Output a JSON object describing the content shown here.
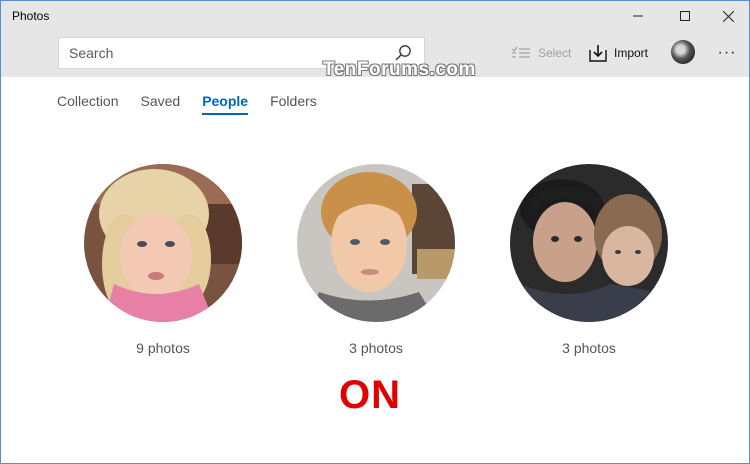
{
  "window": {
    "title": "Photos"
  },
  "titlebar": {
    "minimize_icon": "minimize-icon",
    "maximize_icon": "maximize-icon",
    "close_icon": "close-icon"
  },
  "toolbar": {
    "search": {
      "placeholder": "Search",
      "value": ""
    },
    "select_label": "Select",
    "import_label": "Import",
    "more_label": "···"
  },
  "watermark": "TenForums.com",
  "tabs": [
    {
      "label": "Collection",
      "active": false
    },
    {
      "label": "Saved",
      "active": false
    },
    {
      "label": "People",
      "active": true
    },
    {
      "label": "Folders",
      "active": false
    }
  ],
  "people": [
    {
      "count_label": "9 photos"
    },
    {
      "count_label": "3 photos"
    },
    {
      "count_label": "3 photos"
    }
  ],
  "annotation": "ON",
  "colors": {
    "accent": "#0067b8",
    "titlebar": "#e6e6e6",
    "annotation": "#e00000"
  }
}
